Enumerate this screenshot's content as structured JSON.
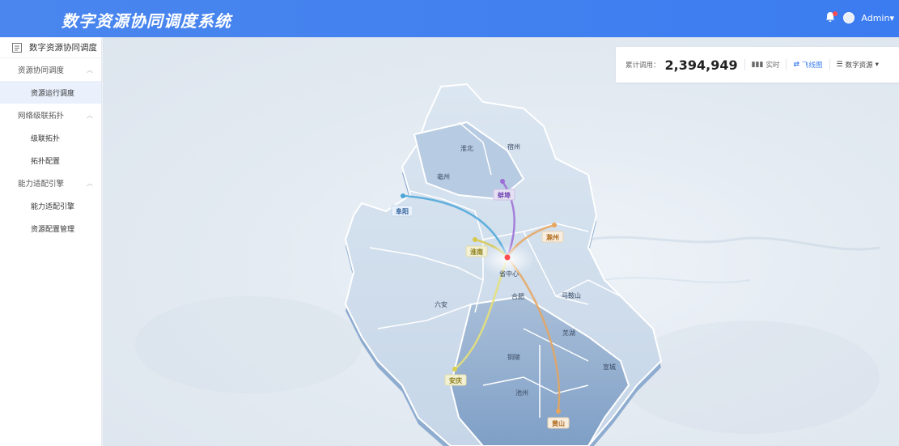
{
  "header": {
    "title": "数字资源协同调度系统",
    "user": "Admin"
  },
  "sidebar": {
    "head": "数字资源协同调度",
    "groups": [
      {
        "label": "资源协同调度",
        "items": [
          {
            "label": "资源运行调度",
            "active": true
          }
        ]
      },
      {
        "label": "网络级联拓扑",
        "items": [
          {
            "label": "级联拓扑"
          },
          {
            "label": "拓扑配置"
          }
        ]
      },
      {
        "label": "能力适配引擎",
        "items": [
          {
            "label": "能力适配引擎"
          },
          {
            "label": "资源配置管理"
          }
        ]
      }
    ]
  },
  "stats": {
    "label": "累计调用：",
    "value": "2,394,949",
    "options": [
      {
        "label": "实时",
        "icon": "bar-chart-icon"
      },
      {
        "label": "飞线图",
        "icon": "flight-map-icon",
        "active": true
      },
      {
        "label": "数字资源",
        "icon": "list-icon",
        "dropdown": true
      }
    ]
  },
  "map": {
    "center_label": "省中心",
    "region_labels": [
      "淮北",
      "宿州",
      "亳州",
      "六安",
      "合肥",
      "马鞍山",
      "芜湖",
      "铜陵",
      "池州",
      "宣城"
    ],
    "callouts": [
      {
        "name": "阜阳",
        "color": "#4aa6d8"
      },
      {
        "name": "蚌埠",
        "color": "#9b6bd6"
      },
      {
        "name": "滁州",
        "color": "#e8a45a"
      },
      {
        "name": "淮南",
        "color": "#d8c84a"
      },
      {
        "name": "安庆",
        "color": "#d8d04a"
      },
      {
        "name": "黄山",
        "color": "#e8a45a"
      }
    ],
    "center_color": "#ff4d4f"
  }
}
